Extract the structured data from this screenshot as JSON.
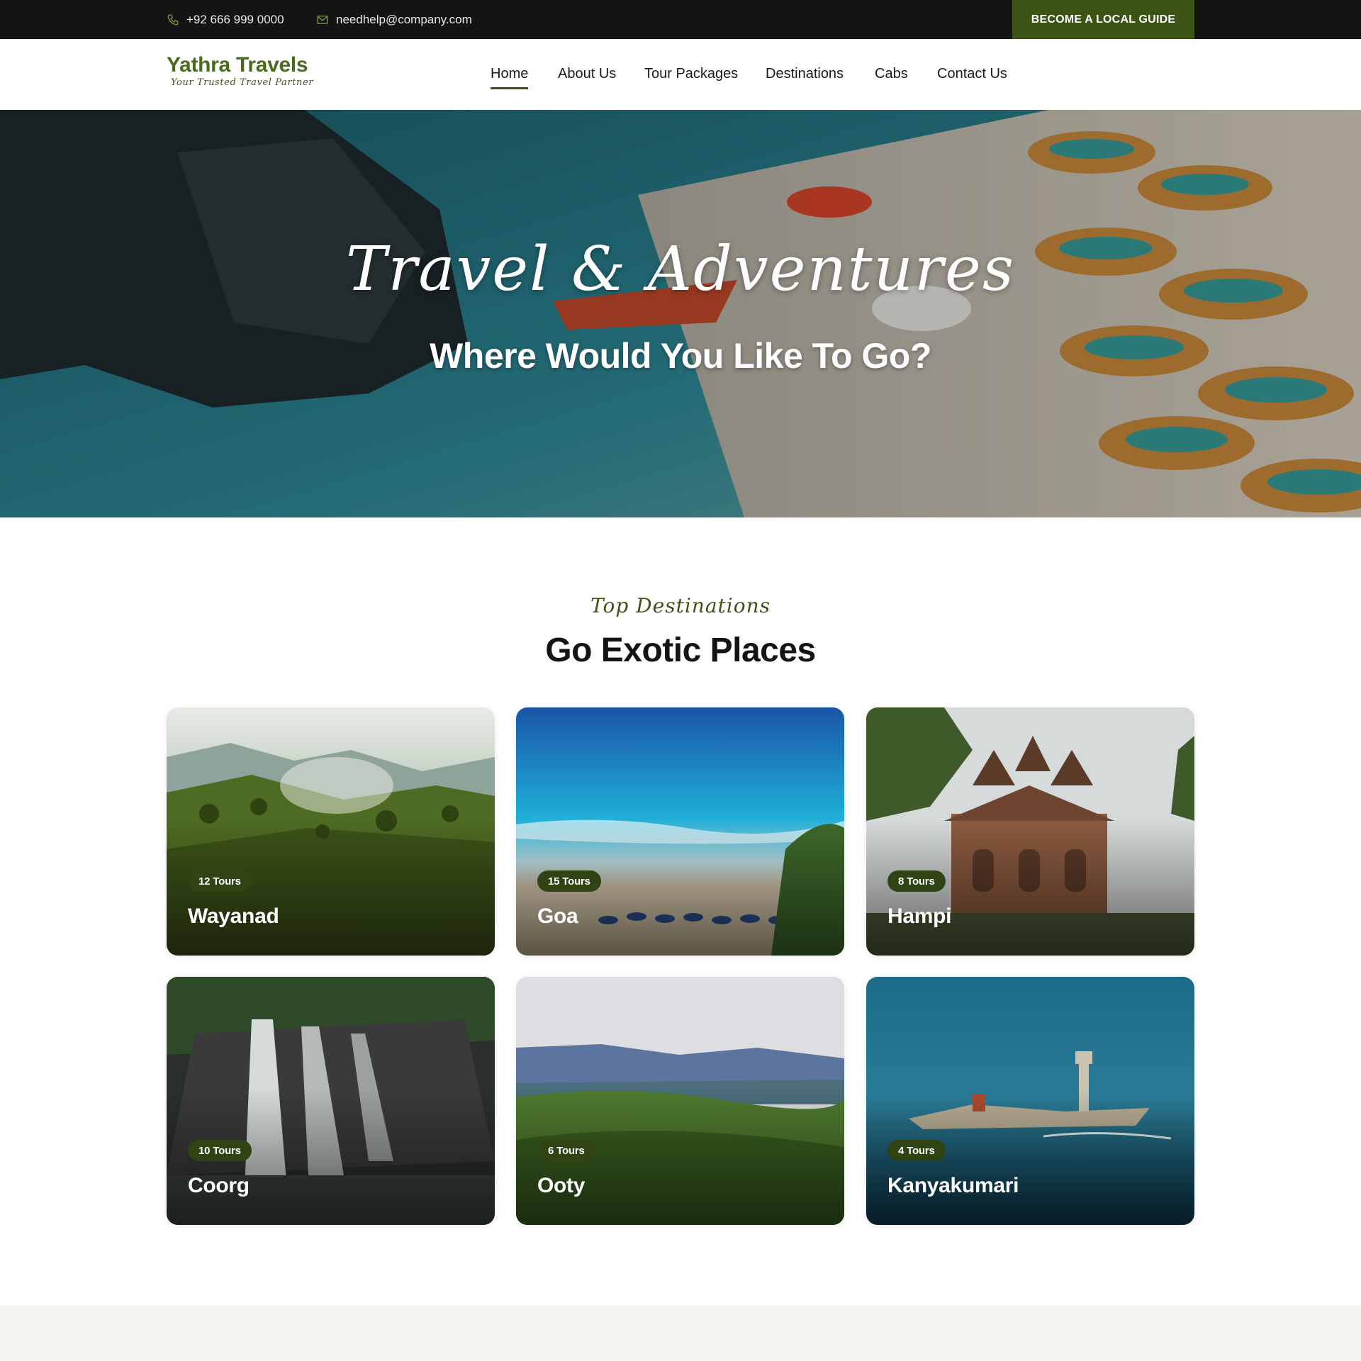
{
  "topbar": {
    "phone": "+92 666 999 0000",
    "email": "needhelp@company.com",
    "guide_button": "BECOME A LOCAL GUIDE",
    "phone_icon": "phone-icon",
    "email_icon": "mail-icon"
  },
  "header": {
    "logo_title": "Yathra Travels",
    "logo_tagline": "Your Trusted Travel Partner",
    "nav": [
      {
        "label": "Home",
        "active": true
      },
      {
        "label": "About Us"
      },
      {
        "label": "Tour Packages"
      },
      {
        "label": "Destinations"
      },
      {
        "label": "Cabs"
      },
      {
        "label": "Contact Us"
      }
    ]
  },
  "hero": {
    "title": "Travel & Adventures",
    "subtitle": "Where Would You Like To Go?"
  },
  "section": {
    "eyebrow": "Top Destinations",
    "title": "Go Exotic Places"
  },
  "destinations": [
    {
      "name": "Wayanad",
      "tours": "12 Tours"
    },
    {
      "name": "Goa",
      "tours": "15 Tours"
    },
    {
      "name": "Hampi",
      "tours": "8 Tours"
    },
    {
      "name": "Coorg",
      "tours": "10 Tours"
    },
    {
      "name": "Ooty",
      "tours": "6 Tours"
    },
    {
      "name": "Kanyakumari",
      "tours": "4 Tours"
    }
  ],
  "colors": {
    "brand_green": "#3b5416",
    "logo_green": "#4a6b1e",
    "topbar_bg": "#141414",
    "badge_bg": "#2f4412"
  }
}
